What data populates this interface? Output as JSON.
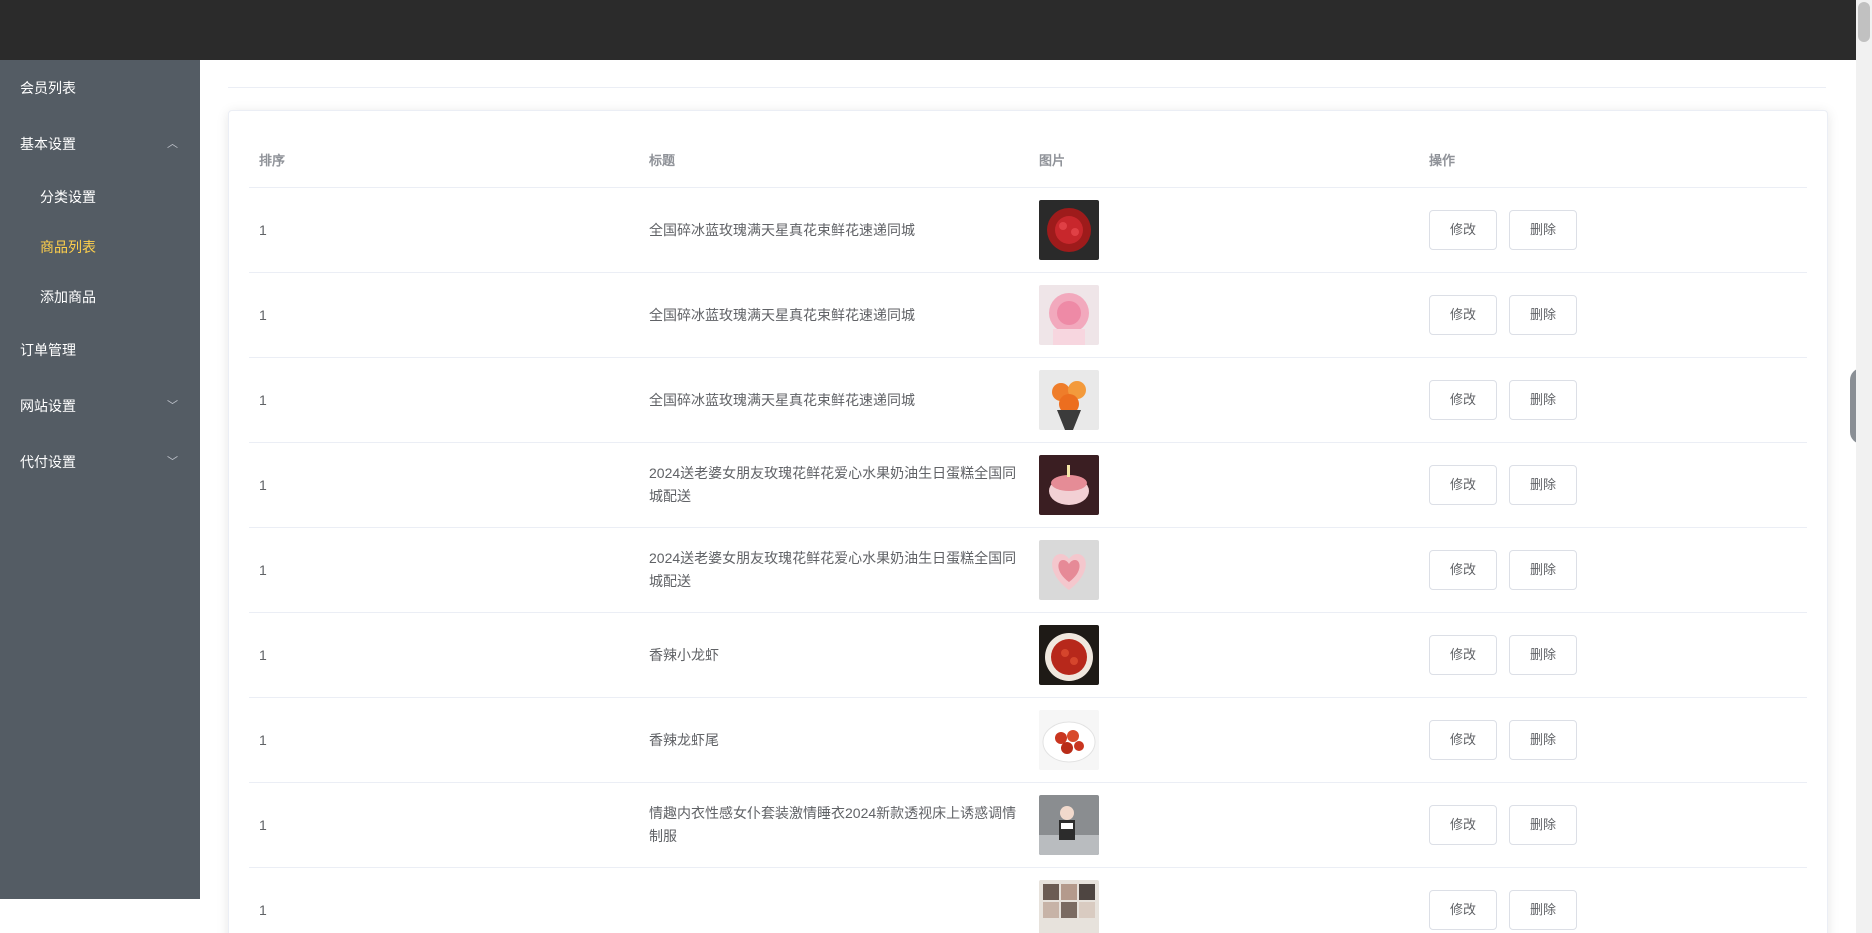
{
  "sidebar": {
    "items": [
      {
        "label": "会员列表"
      },
      {
        "label": "基本设置",
        "chevron": "︿"
      },
      {
        "label": "订单管理"
      },
      {
        "label": "网站设置",
        "chevron": "﹀"
      },
      {
        "label": "代付设置",
        "chevron": "﹀"
      }
    ],
    "submenu": [
      {
        "label": "分类设置"
      },
      {
        "label": "商品列表",
        "active": true
      },
      {
        "label": "添加商品"
      }
    ]
  },
  "table": {
    "headers": {
      "sort": "排序",
      "title": "标题",
      "image": "图片",
      "action": "操作"
    },
    "edit_label": "修改",
    "delete_label": "删除",
    "rows": [
      {
        "sort": "1",
        "title": "全国碎冰蓝玫瑰满天星真花束鲜花速递同城",
        "image": "red-rose-bouquet"
      },
      {
        "sort": "1",
        "title": "全国碎冰蓝玫瑰满天星真花束鲜花速递同城",
        "image": "pink-rose-bouquet"
      },
      {
        "sort": "1",
        "title": "全国碎冰蓝玫瑰满天星真花束鲜花速递同城",
        "image": "orange-flower-bouquet"
      },
      {
        "sort": "1",
        "title": "2024送老婆女朋友玫瑰花鲜花爱心水果奶油生日蛋糕全国同城配送",
        "image": "birthday-cake"
      },
      {
        "sort": "1",
        "title": "2024送老婆女朋友玫瑰花鲜花爱心水果奶油生日蛋糕全国同城配送",
        "image": "heart-cake"
      },
      {
        "sort": "1",
        "title": "香辣小龙虾",
        "image": "spicy-crayfish"
      },
      {
        "sort": "1",
        "title": "香辣龙虾尾",
        "image": "crayfish-tails"
      },
      {
        "sort": "1",
        "title": "情趣内衣性感女仆套装激情睡衣2024新款透视床上诱惑调情制服",
        "image": "lingerie-photo"
      },
      {
        "sort": "1",
        "title": "",
        "image": "collage-photo"
      }
    ]
  },
  "colors": {
    "topbar": "#2b2b2b",
    "sidebar": "#545c64",
    "active_menu": "#ffd04b"
  }
}
